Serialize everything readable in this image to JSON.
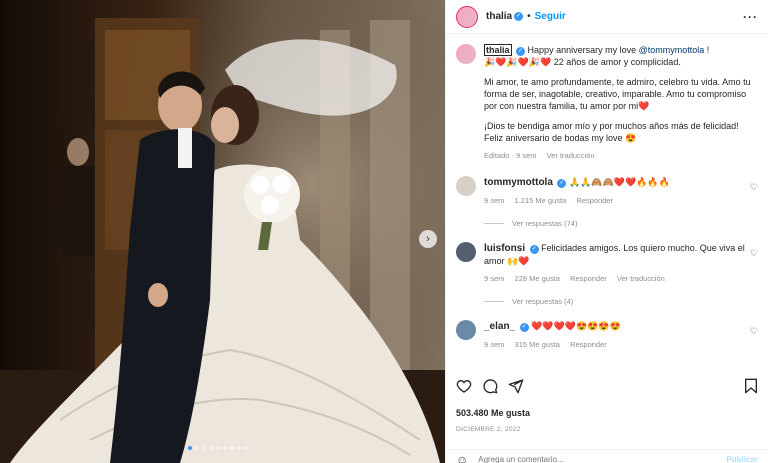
{
  "post": {
    "username": "thalia",
    "follow_label": "Seguir",
    "caption": {
      "username": "thalia",
      "line1_prefix": "Happy anniversary my love ",
      "line1_mention": "@tommymottola",
      "line1_suffix": " !",
      "line2_emojis": "🎉❤️🎉❤️🎉❤️",
      "line2_text": " 22 años de amor y complicidad.",
      "para2": "Mi amor, te amo profundamente, te admiro, celebro tu vida. Amo tu forma de ser, inagotable, creativo, imparable. Amo tu compromiso por con nuestra familia, tu amor por mi❤️",
      "para3": "¡Dios te bendiga amor mío y por muchos años más de felicidad! Feliz aniversario de bodas my love 😍",
      "edited": "Editado · 9 sem",
      "translate": "Ver traducción"
    },
    "comments": [
      {
        "username": "tommymottola",
        "verified": true,
        "text": "🙏🙏🙈🙈❤️❤️🔥🔥🔥",
        "age": "9 sem",
        "likes": "1.215 Me gusta",
        "reply": "Responder",
        "translate": "",
        "view_replies": "Ver respuestas (74)"
      },
      {
        "username": "luisfonsi",
        "verified": true,
        "text": "Felicidades amigos. Los quiero mucho. Que viva el amor 🙌❤️",
        "age": "9 sem",
        "likes": "228 Me gusta",
        "reply": "Responder",
        "translate": "Ver traducción",
        "view_replies": "Ver respuestas (4)"
      },
      {
        "username": "_elan_",
        "verified": true,
        "text": "❤️❤️❤️❤️😍😍😍😍",
        "age": "9 sem",
        "likes": "315 Me gusta",
        "reply": "Responder",
        "translate": "",
        "view_replies": ""
      }
    ],
    "likes": "503.480 Me gusta",
    "date": "DICIEMBRE 2, 2022",
    "add_comment_placeholder": "Agrega un comentario...",
    "publish_label": "Publicar"
  },
  "icons": {
    "verified": "verified-badge-icon",
    "more": "more-options-icon",
    "next": "chevron-right-icon",
    "like": "heart-icon",
    "comment": "comment-icon",
    "share": "paper-plane-icon",
    "save": "bookmark-icon",
    "emoji": "smiley-icon"
  },
  "colors": {
    "accent": "#0095f6",
    "text": "#262626",
    "muted": "#8e8e8e"
  }
}
